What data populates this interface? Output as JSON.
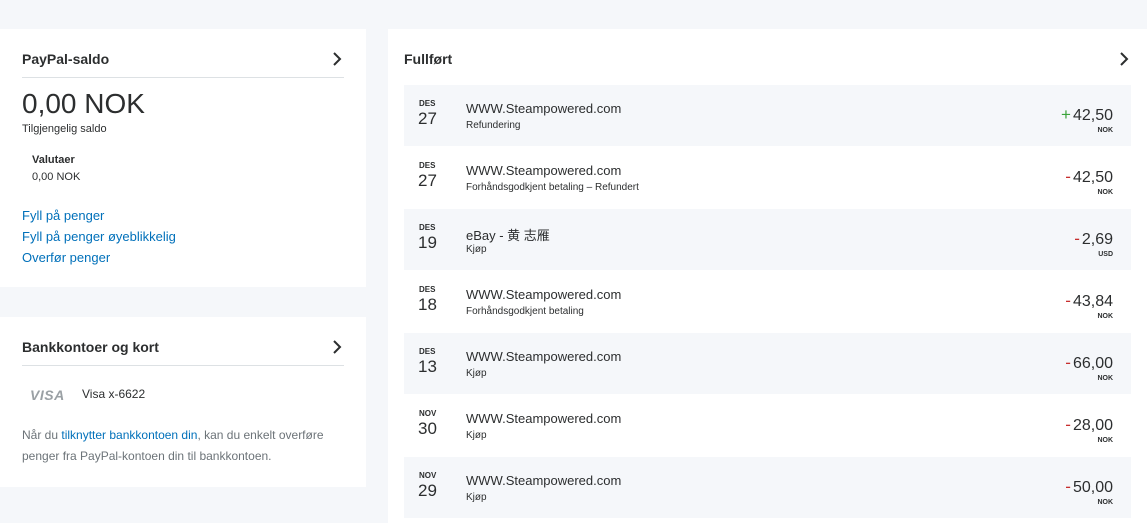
{
  "balance": {
    "title": "PayPal-saldo",
    "amount": "0,00 NOK",
    "subtitle": "Tilgjengelig saldo",
    "currencies_label": "Valutaer",
    "currencies_value": "0,00 NOK",
    "links": [
      "Fyll på penger",
      "Fyll på penger øyeblikkelig",
      "Overfør penger"
    ]
  },
  "bank": {
    "title": "Bankkontoer og kort",
    "card_brand": "VISA",
    "card_number": "Visa x-6622",
    "text_before": "Når du ",
    "text_link": "tilknytter bankkontoen din",
    "text_after": ", kan du enkelt overføre penger fra PayPal-kontoen din til bankkontoen."
  },
  "activity": {
    "title": "Fullført",
    "transactions": [
      {
        "month": "DES",
        "day": "27",
        "name": "WWW.Steampowered.com",
        "type": "Refundering",
        "sign": "+",
        "amount": "42,50",
        "currency": "NOK"
      },
      {
        "month": "DES",
        "day": "27",
        "name": "WWW.Steampowered.com",
        "type": "Forhåndsgodkjent betaling – Refundert",
        "sign": "-",
        "amount": "42,50",
        "currency": "NOK"
      },
      {
        "month": "DES",
        "day": "19",
        "name": "eBay - 黄 志雁",
        "type": "Kjøp",
        "sign": "-",
        "amount": "2,69",
        "currency": "USD"
      },
      {
        "month": "DES",
        "day": "18",
        "name": "WWW.Steampowered.com",
        "type": "Forhåndsgodkjent betaling",
        "sign": "-",
        "amount": "43,84",
        "currency": "NOK"
      },
      {
        "month": "DES",
        "day": "13",
        "name": "WWW.Steampowered.com",
        "type": "Kjøp",
        "sign": "-",
        "amount": "66,00",
        "currency": "NOK"
      },
      {
        "month": "NOV",
        "day": "30",
        "name": "WWW.Steampowered.com",
        "type": "Kjøp",
        "sign": "-",
        "amount": "28,00",
        "currency": "NOK"
      },
      {
        "month": "NOV",
        "day": "29",
        "name": "WWW.Steampowered.com",
        "type": "Kjøp",
        "sign": "-",
        "amount": "50,00",
        "currency": "NOK"
      }
    ]
  },
  "colors": {
    "link": "#0070ba",
    "positive": "#3aa33a",
    "negative": "#c72e2e"
  }
}
